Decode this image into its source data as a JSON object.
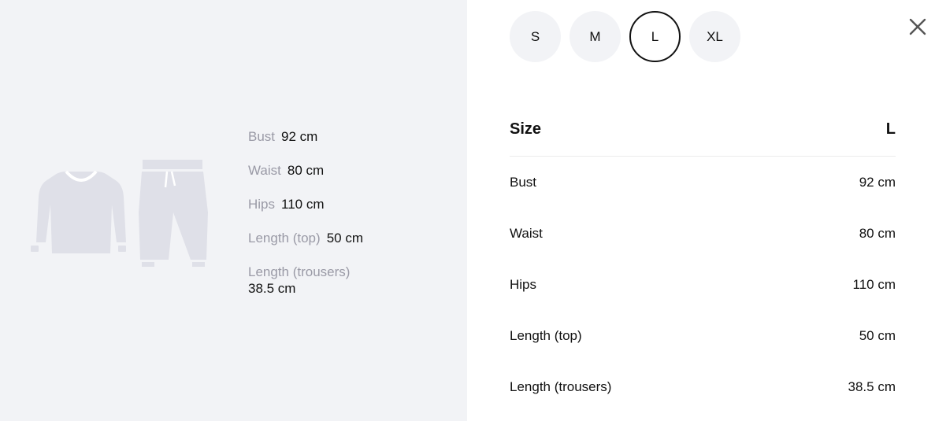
{
  "illustration": {
    "garments": [
      "sweatshirt-icon",
      "trousers-icon"
    ],
    "color": "#dfe0e8"
  },
  "measurements": [
    {
      "label": "Bust",
      "value": "92 cm"
    },
    {
      "label": "Waist",
      "value": "80 cm"
    },
    {
      "label": "Hips",
      "value": "110 cm"
    },
    {
      "label": "Length (top)",
      "value": "50 cm"
    },
    {
      "label": "Length (trousers)",
      "value": "38.5 cm"
    }
  ],
  "sizes": [
    {
      "label": "S",
      "selected": false
    },
    {
      "label": "M",
      "selected": false
    },
    {
      "label": "L",
      "selected": true
    },
    {
      "label": "XL",
      "selected": false
    }
  ],
  "table": {
    "header": {
      "label": "Size",
      "value": "L"
    },
    "rows": [
      {
        "label": "Bust",
        "value": "92 cm"
      },
      {
        "label": "Waist",
        "value": "80 cm"
      },
      {
        "label": "Hips",
        "value": "110 cm"
      },
      {
        "label": "Length (top)",
        "value": "50 cm"
      },
      {
        "label": "Length (trousers)",
        "value": "38.5 cm"
      }
    ]
  },
  "close_icon": "close-icon",
  "colors": {
    "panel_bg": "#f2f3f6",
    "selected_border": "#111111",
    "muted_text": "#9a9aa6"
  }
}
